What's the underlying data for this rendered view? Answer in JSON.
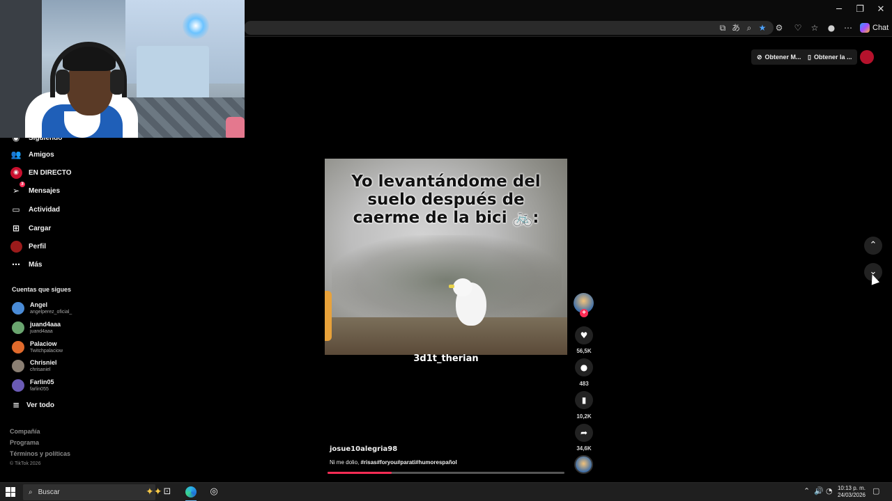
{
  "browser": {
    "chat_label": "Chat",
    "window_controls": [
      "minimize",
      "restore",
      "close"
    ],
    "toolbar_icons": [
      "app-available-icon",
      "translate-icon",
      "zoom-icon",
      "favorite-star-icon",
      "extensions-icon",
      "browser-essentials-icon",
      "favorites-icon",
      "profile-icon",
      "more-icon"
    ]
  },
  "tiktok_header": {
    "get_app_label": "Obtener M...",
    "get_desktop_label": "Obtener la ..."
  },
  "sidebar": {
    "partial_item": "Siguiendo",
    "items": [
      {
        "label": "Amigos",
        "icon": "friends-icon"
      },
      {
        "label": "EN DIRECTO",
        "icon": "live-icon"
      },
      {
        "label": "Mensajes",
        "icon": "messages-icon",
        "badge": "3"
      },
      {
        "label": "Actividad",
        "icon": "activity-icon"
      },
      {
        "label": "Cargar",
        "icon": "upload-icon"
      },
      {
        "label": "Perfil",
        "icon": "profile-icon"
      },
      {
        "label": "Más",
        "icon": "more-icon"
      }
    ],
    "following_title": "Cuentas que sigues",
    "accounts": [
      {
        "name": "Angel",
        "handle": "angelperez_oficial_",
        "color": "#4a8bd6"
      },
      {
        "name": "juand4aaa",
        "handle": "juand4aaa",
        "color": "#6aa56f"
      },
      {
        "name": "Palaciow",
        "handle": "Twitchpalaciow",
        "color": "#e06a2c"
      },
      {
        "name": "Chrisniel",
        "handle": "chrisaniel",
        "color": "#8a7f73"
      },
      {
        "name": "Farlin05",
        "handle": "farlin055",
        "color": "#6b5bb5"
      }
    ],
    "see_all": "Ver todo",
    "footer_links": [
      "Compañía",
      "Programa",
      "Términos y políticas"
    ],
    "copyright": "© TikTok 2026"
  },
  "video": {
    "caption": "Yo levantándome del suelo después de caerme de la bici 🚲:",
    "overlay_username": "3d1t_therian",
    "author": "josue10alegria98",
    "description_text": "Ni me dolio, ",
    "description_tags": "#risas#foryou#parati#humorespañol",
    "progress_percent": 27
  },
  "actions": {
    "likes": "56,5K",
    "comments": "483",
    "saves": "10,2K",
    "shares": "34,6K"
  },
  "taskbar": {
    "search_placeholder": "Buscar",
    "time": "10:13 p. m.",
    "date": "24/03/2026"
  }
}
